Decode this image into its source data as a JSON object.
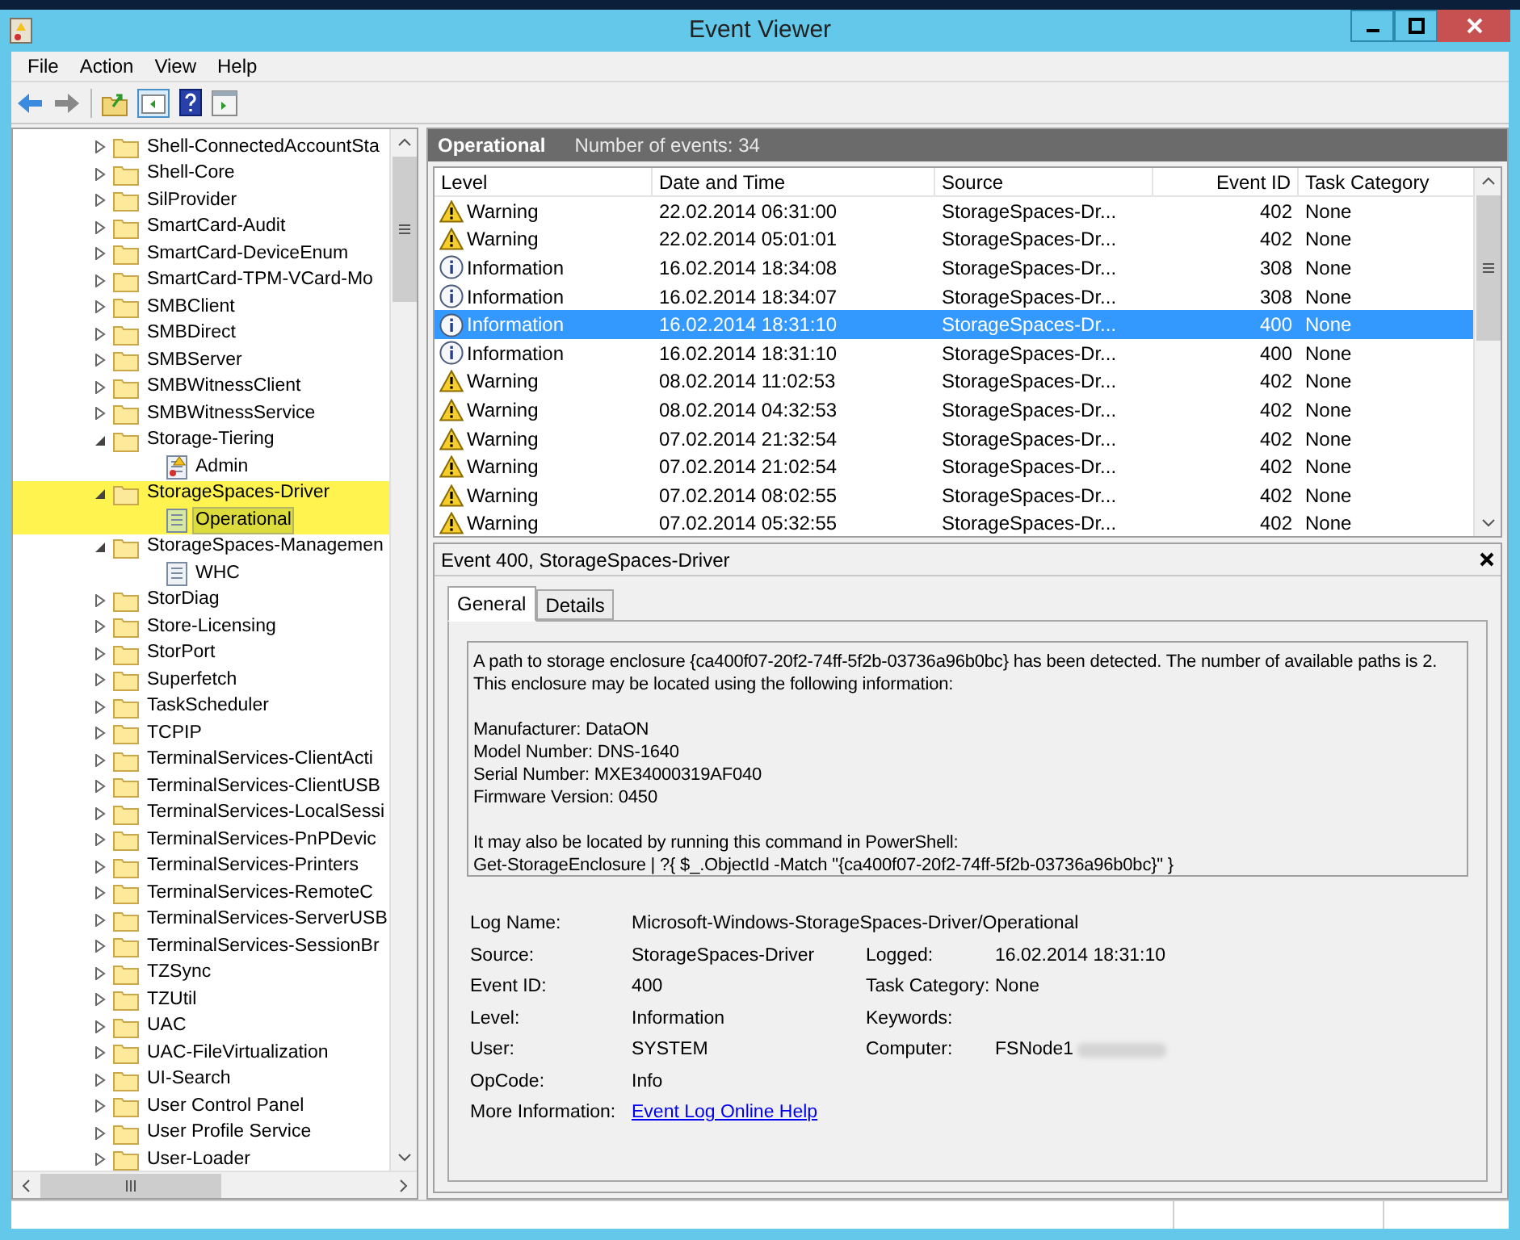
{
  "window": {
    "title": "Event Viewer"
  },
  "menu": [
    "File",
    "Action",
    "View",
    "Help"
  ],
  "tree": [
    {
      "name": "Shell-ConnectedAccountSta",
      "kind": "folder",
      "expanded": false,
      "selected": false,
      "highlighted": false
    },
    {
      "name": "Shell-Core",
      "kind": "folder",
      "expanded": false,
      "selected": false,
      "highlighted": false
    },
    {
      "name": "SilProvider",
      "kind": "folder",
      "expanded": false,
      "selected": false,
      "highlighted": false
    },
    {
      "name": "SmartCard-Audit",
      "kind": "folder",
      "expanded": false,
      "selected": false,
      "highlighted": false
    },
    {
      "name": "SmartCard-DeviceEnum",
      "kind": "folder",
      "expanded": false,
      "selected": false,
      "highlighted": false
    },
    {
      "name": "SmartCard-TPM-VCard-Mo",
      "kind": "folder",
      "expanded": false,
      "selected": false,
      "highlighted": false
    },
    {
      "name": "SMBClient",
      "kind": "folder",
      "expanded": false,
      "selected": false,
      "highlighted": false
    },
    {
      "name": "SMBDirect",
      "kind": "folder",
      "expanded": false,
      "selected": false,
      "highlighted": false
    },
    {
      "name": "SMBServer",
      "kind": "folder",
      "expanded": false,
      "selected": false,
      "highlighted": false
    },
    {
      "name": "SMBWitnessClient",
      "kind": "folder",
      "expanded": false,
      "selected": false,
      "highlighted": false
    },
    {
      "name": "SMBWitnessService",
      "kind": "folder",
      "expanded": false,
      "selected": false,
      "highlighted": false
    },
    {
      "name": "Storage-Tiering",
      "kind": "folder",
      "expanded": true,
      "selected": false,
      "highlighted": false,
      "children": [
        {
          "name": "Admin",
          "kind": "admin-log",
          "selected": false,
          "highlighted": false
        }
      ]
    },
    {
      "name": "StorageSpaces-Driver",
      "kind": "folder",
      "expanded": true,
      "selected": false,
      "highlighted": true,
      "children": [
        {
          "name": "Operational",
          "kind": "operational-log",
          "selected": true,
          "highlighted": true
        }
      ]
    },
    {
      "name": "StorageSpaces-Managemen",
      "kind": "folder",
      "expanded": true,
      "selected": false,
      "highlighted": false,
      "children": [
        {
          "name": "WHC",
          "kind": "log",
          "selected": false,
          "highlighted": false
        }
      ]
    },
    {
      "name": "StorDiag",
      "kind": "folder",
      "expanded": false,
      "selected": false,
      "highlighted": false
    },
    {
      "name": "Store-Licensing",
      "kind": "folder",
      "expanded": false,
      "selected": false,
      "highlighted": false
    },
    {
      "name": "StorPort",
      "kind": "folder",
      "expanded": false,
      "selected": false,
      "highlighted": false
    },
    {
      "name": "Superfetch",
      "kind": "folder",
      "expanded": false,
      "selected": false,
      "highlighted": false
    },
    {
      "name": "TaskScheduler",
      "kind": "folder",
      "expanded": false,
      "selected": false,
      "highlighted": false
    },
    {
      "name": "TCPIP",
      "kind": "folder",
      "expanded": false,
      "selected": false,
      "highlighted": false
    },
    {
      "name": "TerminalServices-ClientActi",
      "kind": "folder",
      "expanded": false,
      "selected": false,
      "highlighted": false
    },
    {
      "name": "TerminalServices-ClientUSB",
      "kind": "folder",
      "expanded": false,
      "selected": false,
      "highlighted": false
    },
    {
      "name": "TerminalServices-LocalSessi",
      "kind": "folder",
      "expanded": false,
      "selected": false,
      "highlighted": false
    },
    {
      "name": "TerminalServices-PnPDevic",
      "kind": "folder",
      "expanded": false,
      "selected": false,
      "highlighted": false
    },
    {
      "name": "TerminalServices-Printers",
      "kind": "folder",
      "expanded": false,
      "selected": false,
      "highlighted": false
    },
    {
      "name": "TerminalServices-RemoteC",
      "kind": "folder",
      "expanded": false,
      "selected": false,
      "highlighted": false
    },
    {
      "name": "TerminalServices-ServerUSB",
      "kind": "folder",
      "expanded": false,
      "selected": false,
      "highlighted": false
    },
    {
      "name": "TerminalServices-SessionBr",
      "kind": "folder",
      "expanded": false,
      "selected": false,
      "highlighted": false
    },
    {
      "name": "TZSync",
      "kind": "folder",
      "expanded": false,
      "selected": false,
      "highlighted": false
    },
    {
      "name": "TZUtil",
      "kind": "folder",
      "expanded": false,
      "selected": false,
      "highlighted": false
    },
    {
      "name": "UAC",
      "kind": "folder",
      "expanded": false,
      "selected": false,
      "highlighted": false
    },
    {
      "name": "UAC-FileVirtualization",
      "kind": "folder",
      "expanded": false,
      "selected": false,
      "highlighted": false
    },
    {
      "name": "UI-Search",
      "kind": "folder",
      "expanded": false,
      "selected": false,
      "highlighted": false
    },
    {
      "name": "User Control Panel",
      "kind": "folder",
      "expanded": false,
      "selected": false,
      "highlighted": false
    },
    {
      "name": "User Profile Service",
      "kind": "folder",
      "expanded": false,
      "selected": false,
      "highlighted": false
    },
    {
      "name": "User-Loader",
      "kind": "folder",
      "expanded": false,
      "selected": false,
      "highlighted": false
    }
  ],
  "log_header": {
    "title": "Operational",
    "count": "Number of events: 34"
  },
  "table": {
    "columns": [
      "Level",
      "Date and Time",
      "Source",
      "Event ID",
      "Task Category"
    ],
    "rows": [
      {
        "kind": "warning",
        "level": "Warning",
        "date": "22.02.2014 06:31:00",
        "source": "StorageSpaces-Dr...",
        "event_id": "402",
        "category": "None",
        "selected": false
      },
      {
        "kind": "warning",
        "level": "Warning",
        "date": "22.02.2014 05:01:01",
        "source": "StorageSpaces-Dr...",
        "event_id": "402",
        "category": "None",
        "selected": false
      },
      {
        "kind": "information",
        "level": "Information",
        "date": "16.02.2014 18:34:08",
        "source": "StorageSpaces-Dr...",
        "event_id": "308",
        "category": "None",
        "selected": false
      },
      {
        "kind": "information",
        "level": "Information",
        "date": "16.02.2014 18:34:07",
        "source": "StorageSpaces-Dr...",
        "event_id": "308",
        "category": "None",
        "selected": false
      },
      {
        "kind": "information",
        "level": "Information",
        "date": "16.02.2014 18:31:10",
        "source": "StorageSpaces-Dr...",
        "event_id": "400",
        "category": "None",
        "selected": true
      },
      {
        "kind": "information",
        "level": "Information",
        "date": "16.02.2014 18:31:10",
        "source": "StorageSpaces-Dr...",
        "event_id": "400",
        "category": "None",
        "selected": false
      },
      {
        "kind": "warning",
        "level": "Warning",
        "date": "08.02.2014 11:02:53",
        "source": "StorageSpaces-Dr...",
        "event_id": "402",
        "category": "None",
        "selected": false
      },
      {
        "kind": "warning",
        "level": "Warning",
        "date": "08.02.2014 04:32:53",
        "source": "StorageSpaces-Dr...",
        "event_id": "402",
        "category": "None",
        "selected": false
      },
      {
        "kind": "warning",
        "level": "Warning",
        "date": "07.02.2014 21:32:54",
        "source": "StorageSpaces-Dr...",
        "event_id": "402",
        "category": "None",
        "selected": false
      },
      {
        "kind": "warning",
        "level": "Warning",
        "date": "07.02.2014 21:02:54",
        "source": "StorageSpaces-Dr...",
        "event_id": "402",
        "category": "None",
        "selected": false
      },
      {
        "kind": "warning",
        "level": "Warning",
        "date": "07.02.2014 08:02:55",
        "source": "StorageSpaces-Dr...",
        "event_id": "402",
        "category": "None",
        "selected": false
      },
      {
        "kind": "warning",
        "level": "Warning",
        "date": "07.02.2014 05:32:55",
        "source": "StorageSpaces-Dr...",
        "event_id": "402",
        "category": "None",
        "selected": false
      }
    ]
  },
  "details": {
    "title": "Event 400, StorageSpaces-Driver",
    "tabs": [
      {
        "label": "General",
        "selected": true
      },
      {
        "label": "Details",
        "selected": false
      }
    ],
    "message": [
      [
        "A path to storage enclosure {ca400f07-20f2-74ff-5f2b-03736a96b0bc} has been detected. The number of available paths is 2.",
        "This enclosure may be located using the following information:"
      ],
      [
        "Manufacturer: DataON",
        "Model Number: DNS-1640",
        "Serial Number: MXE34000319AF040",
        "Firmware Version: 0450"
      ],
      [
        "It may also be located by running this command in PowerShell:",
        "Get-StorageEnclosure | ?{ $_.ObjectId -Match \"{ca400f07-20f2-74ff-5f2b-03736a96b0bc}\" }"
      ]
    ],
    "log_name": {
      "label": "Log Name:",
      "value": "Microsoft-Windows-StorageSpaces-Driver/Operational"
    },
    "fields": [
      {
        "label": "Source:",
        "value": "StorageSpaces-Driver",
        "label_2": "Logged:",
        "value_2": "16.02.2014 18:31:10"
      },
      {
        "label": "Event ID:",
        "value": "400",
        "label_2": "Task Category:",
        "value_2": "None"
      },
      {
        "label": "Level:",
        "value": "Information",
        "label_2": "Keywords:"
      },
      {
        "label": "User:",
        "value": "SYSTEM",
        "label_2": "Computer:",
        "value_2": "FSNode1",
        "blurred": true
      },
      {
        "label": "OpCode:",
        "value": "Info"
      }
    ],
    "more_info": {
      "label": "More Information:",
      "link": "Event Log Online Help"
    }
  }
}
